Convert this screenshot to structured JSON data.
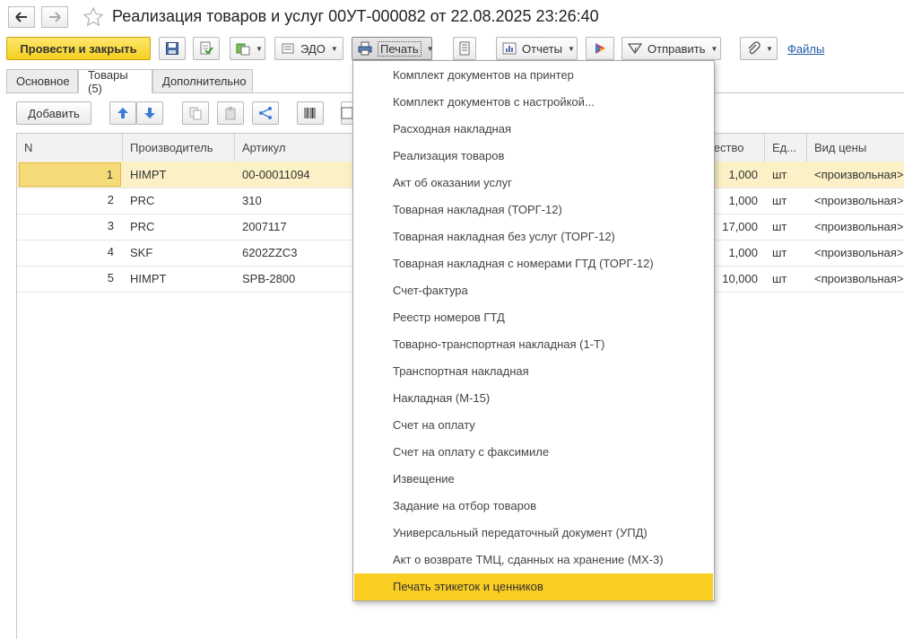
{
  "window": {
    "title": "Реализация товаров и услуг 00УТ-000082 от 22.08.2025 23:26:40"
  },
  "toolbar": {
    "post_close": "Провести и закрыть",
    "edo": "ЭДО",
    "print": "Печать",
    "reports": "Отчеты",
    "send": "Отправить",
    "files": "Файлы"
  },
  "tabs": [
    "Основное",
    "Товары (5)",
    "Дополнительно"
  ],
  "table_toolbar": {
    "add": "Добавить"
  },
  "table": {
    "columns": [
      "N",
      "Производитель",
      "Артикул",
      "чество",
      "Ед...",
      "Вид цены"
    ],
    "rows": [
      {
        "n": "1",
        "maker": "HIMPT",
        "article": "00-00011094",
        "qty": "1,000",
        "unit": "шт",
        "price_type": "<произвольная>"
      },
      {
        "n": "2",
        "maker": "PRC",
        "article": "310",
        "qty": "1,000",
        "unit": "шт",
        "price_type": "<произвольная>"
      },
      {
        "n": "3",
        "maker": "PRC",
        "article": "2007117",
        "qty": "17,000",
        "unit": "шт",
        "price_type": "<произвольная>"
      },
      {
        "n": "4",
        "maker": "SKF",
        "article": "6202ZZC3",
        "qty": "1,000",
        "unit": "шт",
        "price_type": "<произвольная>"
      },
      {
        "n": "5",
        "maker": "HIMPT",
        "article": "SPB-2800",
        "qty": "10,000",
        "unit": "шт",
        "price_type": "<произвольная>"
      }
    ]
  },
  "print_menu": {
    "items": [
      "Комплект документов на принтер",
      "Комплект документов с настройкой...",
      "Расходная накладная",
      "Реализация товаров",
      "Акт об оказании услуг",
      "Товарная накладная (ТОРГ-12)",
      "Товарная накладная без услуг (ТОРГ-12)",
      "Товарная накладная с номерами ГТД (ТОРГ-12)",
      "Счет-фактура",
      "Реестр номеров ГТД",
      "Товарно-транспортная накладная (1-Т)",
      "Транспортная накладная",
      "Накладная (М-15)",
      "Счет на оплату",
      "Счет на оплату с факсимиле",
      "Извещение",
      "Задание на отбор товаров",
      "Универсальный передаточный документ (УПД)",
      "Акт о возврате ТМЦ, сданных на хранение (МХ-3)",
      "Печать этикеток и ценников"
    ],
    "highlighted_index": 19
  },
  "colors": {
    "primary_button": "#f4cf21",
    "menu_highlight": "#f9cd22",
    "selected_row": "#fbf0c6",
    "link": "#1f5aa8"
  }
}
